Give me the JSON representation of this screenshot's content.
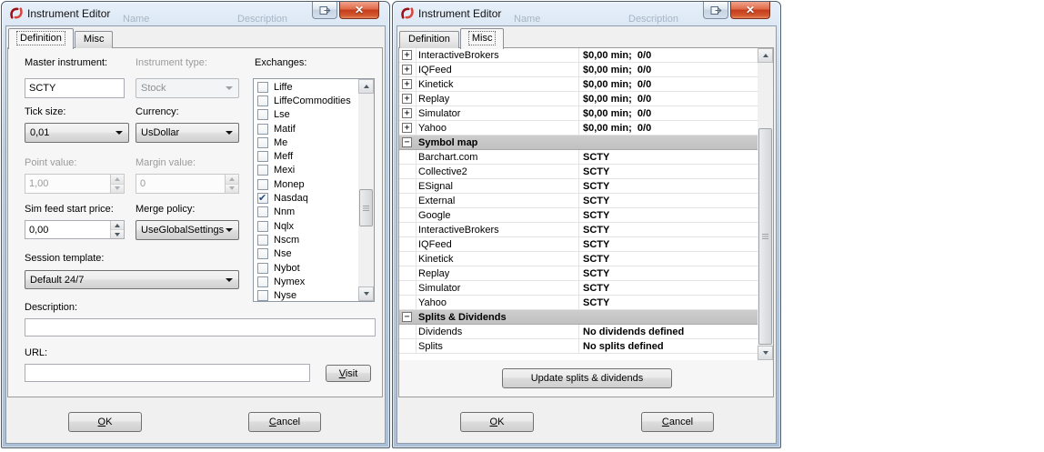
{
  "background_ghost": {
    "name": "Name",
    "description": "Description"
  },
  "left": {
    "title": "Instrument Editor",
    "tabs": {
      "definition": "Definition",
      "misc": "Misc"
    },
    "fields": {
      "master_instrument": {
        "label": "Master instrument:",
        "value": "SCTY"
      },
      "instrument_type": {
        "label": "Instrument type:",
        "value": "Stock"
      },
      "tick_size": {
        "label": "Tick size:",
        "value": "0,01"
      },
      "currency": {
        "label": "Currency:",
        "value": "UsDollar"
      },
      "point_value": {
        "label": "Point value:",
        "value": "1,00"
      },
      "margin_value": {
        "label": "Margin value:",
        "value": "0"
      },
      "sim_feed_start_price": {
        "label": "Sim feed start price:",
        "value": "0,00"
      },
      "merge_policy": {
        "label": "Merge policy:",
        "value": "UseGlobalSettings"
      },
      "session_template": {
        "label": "Session template:",
        "value": "Default 24/7"
      },
      "description": {
        "label": "Description:",
        "value": ""
      },
      "url": {
        "label": "URL:",
        "value": ""
      }
    },
    "exchanges": {
      "label": "Exchanges:",
      "items": [
        {
          "name": "Liffe",
          "checked": false
        },
        {
          "name": "LiffeCommodities",
          "checked": false
        },
        {
          "name": "Lse",
          "checked": false
        },
        {
          "name": "Matif",
          "checked": false
        },
        {
          "name": "Me",
          "checked": false
        },
        {
          "name": "Meff",
          "checked": false
        },
        {
          "name": "Mexi",
          "checked": false
        },
        {
          "name": "Monep",
          "checked": false
        },
        {
          "name": "Nasdaq",
          "checked": true
        },
        {
          "name": "Nnm",
          "checked": false
        },
        {
          "name": "Nqlx",
          "checked": false
        },
        {
          "name": "Nscm",
          "checked": false
        },
        {
          "name": "Nse",
          "checked": false
        },
        {
          "name": "Nybot",
          "checked": false
        },
        {
          "name": "Nymex",
          "checked": false
        },
        {
          "name": "Nyse",
          "checked": false
        }
      ]
    },
    "buttons": {
      "visit": "Visit",
      "ok": "OK",
      "cancel": "Cancel"
    }
  },
  "right": {
    "title": "Instrument Editor",
    "tabs": {
      "definition": "Definition",
      "misc": "Misc"
    },
    "grid": {
      "rows": [
        {
          "type": "item",
          "expander": "+",
          "name": "InteractiveBrokers",
          "value": "$0,00 min;  0/0"
        },
        {
          "type": "item",
          "expander": "+",
          "name": "IQFeed",
          "value": "$0,00 min;  0/0"
        },
        {
          "type": "item",
          "expander": "+",
          "name": "Kinetick",
          "value": "$0,00 min;  0/0"
        },
        {
          "type": "item",
          "expander": "+",
          "name": "Replay",
          "value": "$0,00 min;  0/0"
        },
        {
          "type": "item",
          "expander": "+",
          "name": "Simulator",
          "value": "$0,00 min;  0/0"
        },
        {
          "type": "item",
          "expander": "+",
          "name": "Yahoo",
          "value": "$0,00 min;  0/0"
        },
        {
          "type": "section",
          "expander": "−",
          "name": "Symbol map",
          "value": ""
        },
        {
          "type": "sub",
          "name": "Barchart.com",
          "value": "SCTY"
        },
        {
          "type": "sub",
          "name": "Collective2",
          "value": "SCTY"
        },
        {
          "type": "sub",
          "name": "ESignal",
          "value": "SCTY"
        },
        {
          "type": "sub",
          "name": "External",
          "value": "SCTY"
        },
        {
          "type": "sub",
          "name": "Google",
          "value": "SCTY"
        },
        {
          "type": "sub",
          "name": "InteractiveBrokers",
          "value": "SCTY"
        },
        {
          "type": "sub",
          "name": "IQFeed",
          "value": "SCTY"
        },
        {
          "type": "sub",
          "name": "Kinetick",
          "value": "SCTY"
        },
        {
          "type": "sub",
          "name": "Replay",
          "value": "SCTY"
        },
        {
          "type": "sub",
          "name": "Simulator",
          "value": "SCTY"
        },
        {
          "type": "sub",
          "name": "Yahoo",
          "value": "SCTY"
        },
        {
          "type": "section",
          "expander": "−",
          "name": "Splits & Dividends",
          "value": ""
        },
        {
          "type": "sub",
          "name": "Dividends",
          "value": "No dividends defined"
        },
        {
          "type": "sub",
          "name": "Splits",
          "value": "No splits defined"
        }
      ]
    },
    "buttons": {
      "update": "Update splits & dividends",
      "ok": "OK",
      "cancel": "Cancel"
    }
  }
}
